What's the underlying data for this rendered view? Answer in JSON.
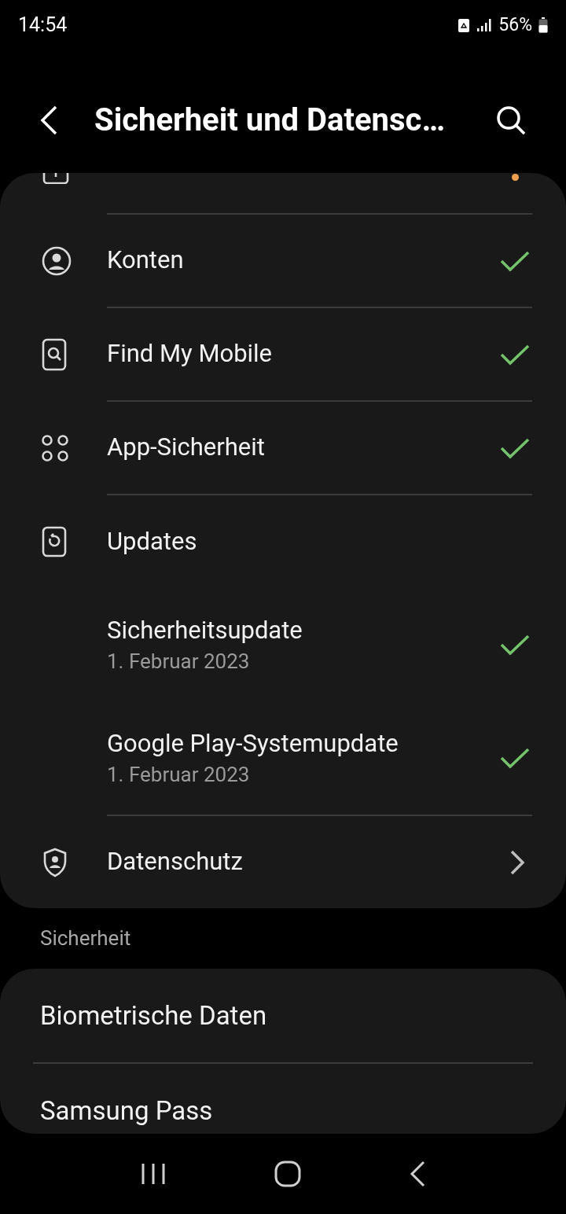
{
  "status_bar": {
    "time": "14:54",
    "battery": "56%"
  },
  "header": {
    "title": "Sicherheit und Datensc…"
  },
  "card": {
    "partial_item": {
      "color": "#f0a050"
    },
    "items": [
      {
        "kind": "status",
        "title": "Konten",
        "checked": true
      },
      {
        "kind": "status",
        "title": "Find My Mobile",
        "checked": true
      },
      {
        "kind": "status",
        "title": "App-Sicherheit",
        "checked": true
      },
      {
        "kind": "group",
        "title": "Updates",
        "children": [
          {
            "title": "Sicherheitsupdate",
            "subtitle": "1. Februar 2023",
            "checked": true
          },
          {
            "title": "Google Play-Systemupdate",
            "subtitle": "1. Februar 2023",
            "checked": true
          }
        ]
      },
      {
        "kind": "link",
        "title": "Datenschutz"
      }
    ]
  },
  "section": {
    "label": "Sicherheit",
    "items": [
      {
        "title": "Biometrische Daten"
      },
      {
        "title": "Samsung Pass"
      }
    ]
  }
}
